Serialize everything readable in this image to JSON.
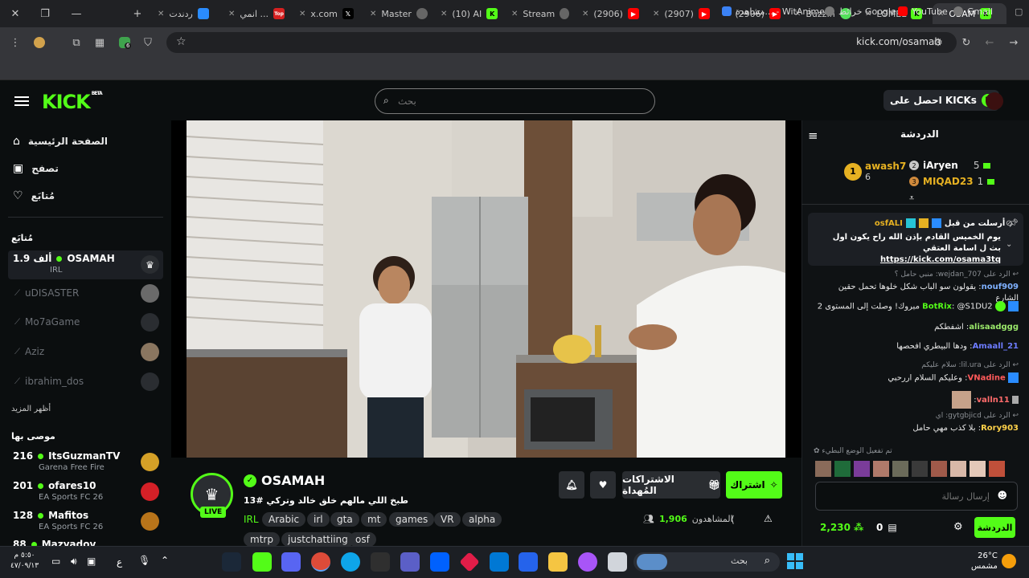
{
  "browser": {
    "tabs": [
      {
        "label": "ردندت"
      },
      {
        "label": "انمي ..."
      },
      {
        "label": "x.com"
      },
      {
        "label": "Master"
      },
      {
        "label": "(10) AI"
      },
      {
        "label": "Stream"
      },
      {
        "label": "(2906)"
      },
      {
        "label": "(2907)"
      },
      {
        "label": "(2906)"
      },
      {
        "label": "BuzzIn"
      },
      {
        "label": "LOMEL"
      },
      {
        "label": "OSAM"
      }
    ],
    "url": "kick.com/osamah",
    "extension_badge": "6",
    "bookmarks": [
      {
        "label": "Gmail"
      },
      {
        "label": "YouTube"
      },
      {
        "label": "خرائط Google"
      },
      {
        "label": "مشاهدة... - WitAnime"
      }
    ]
  },
  "kick": {
    "logo": "KICK",
    "logo_beta": "BETA",
    "search_placeholder": "بحث",
    "get_kicks": "احصل على KICKs"
  },
  "sidebar": {
    "nav": [
      {
        "label": "الصفحة الرئيسية",
        "icon": "home-icon"
      },
      {
        "label": "تصفح",
        "icon": "browse-icon"
      },
      {
        "label": "مُتابَع",
        "icon": "heart-icon"
      }
    ],
    "following_title": "مُتابَع",
    "following": [
      {
        "name": "OSAMAH",
        "viewers": "1.9 ألف",
        "category": "IRL",
        "live": true
      },
      {
        "name": "uDISASTER",
        "live": false
      },
      {
        "name": "Mo7aGame",
        "live": false
      },
      {
        "name": "Aziz",
        "live": false
      },
      {
        "name": "ibrahim_dos",
        "live": false
      }
    ],
    "show_more": "أظهر المزيد",
    "recommended_title": "موصى بها",
    "recommended": [
      {
        "name": "ItsGuzmanTV",
        "viewers": "216",
        "category": "Garena Free Fire"
      },
      {
        "name": "ofares10",
        "viewers": "201",
        "category": "EA Sports FC 26"
      },
      {
        "name": "Mafitos",
        "viewers": "128",
        "category": "EA Sports FC 26"
      },
      {
        "name": "Mazyadov",
        "viewers": "88",
        "category": ""
      }
    ]
  },
  "stream": {
    "channel": "OSAMAH",
    "title": "طبخ اللي مالهم خلق خالد وتركي #13",
    "live_badge": "LIVE",
    "category": "IRL",
    "tags": [
      "Arabic",
      "irl",
      "gta",
      "mt",
      "games",
      "VR",
      "alpha",
      "mtrp",
      "justchattiing",
      "osf"
    ],
    "viewers_label": "المشاهدون",
    "viewers": "1,906",
    "subscribe": "اشتراك",
    "gift_subs": "الاشتراكات المُهداة"
  },
  "chat": {
    "title": "الدردشة",
    "leaderboard": [
      {
        "rank": "1",
        "name": "awash7",
        "count": "6"
      },
      {
        "rank": "2",
        "name": "iAryen",
        "count": "5"
      },
      {
        "rank": "3",
        "name": "MIQAD23",
        "count": "1"
      }
    ],
    "pinned": {
      "pinned_by": "أرسلت من قبل",
      "user": "osfALI",
      "text": "يوم الخميس القادم بإذن الله راح يكون اول بث ل اسامة العتقي",
      "link": "https://kick.com/osama3tq"
    },
    "messages": [
      {
        "reply": "الرد على wejdan_707: منبي حامل ؟",
        "user": "nouf909",
        "text": "يقولون سو الباب شكل خلوها تحمل حقين الشارع",
        "color": "#7fb1ff"
      },
      {
        "reply": "",
        "user": "BotRix",
        "text": "@S1DU2 مبروك! وصلت إلى المستوى 2",
        "color": "#53fc18"
      },
      {
        "reply": "",
        "user": "alisaadggg",
        "text": "اشفطكم",
        "color": "#9ae86a"
      },
      {
        "reply": "",
        "user": "Amaall_21",
        "text": "ودها البيطري افحصها",
        "color": "#6d7cff"
      },
      {
        "reply": "الرد على lil.ura: سلام عليكم",
        "user": "VNadine",
        "text": "وعليكم السلام اررحبي",
        "color": "#ff5a5a"
      },
      {
        "reply": "",
        "user": "valln11",
        "text": "",
        "color": "#ff6b6b"
      },
      {
        "reply": "الرد على gytgbjicd: اي",
        "user": "Rory903",
        "text": "بلا كذب مهي حامل",
        "color": "#ffd24a"
      }
    ],
    "slow_mode": "تم تفعيل الوضع البطيء",
    "input_placeholder": "إرسال رسالة",
    "send_button": "الدردشة",
    "points": "2,230",
    "gifts_count": "0"
  },
  "taskbar": {
    "search_placeholder": "بحث",
    "temperature": "26°C",
    "weather": "مشمس",
    "time": "٥:٥٠ م",
    "date": "٤٧/٠٩/١٣",
    "language": "ع"
  },
  "colors": {
    "accent": "#53fc18",
    "bg": "#0b0e0f"
  }
}
